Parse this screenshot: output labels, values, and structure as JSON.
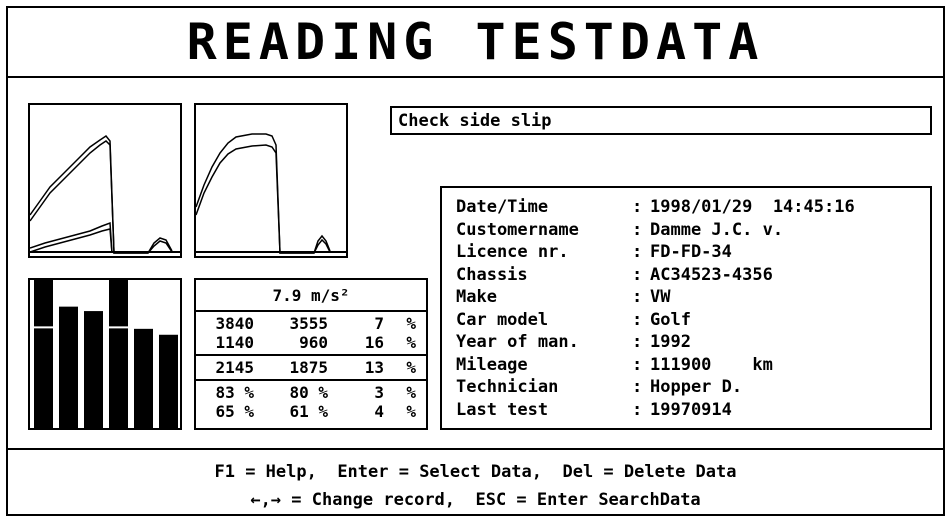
{
  "title": "READING TESTDATA",
  "message": "Check side slip",
  "numbers": {
    "header": "7.9 m/s²",
    "block1": [
      [
        "3840",
        "3555",
        "7",
        "%"
      ],
      [
        "1140",
        "960",
        "16",
        "%"
      ]
    ],
    "block2": [
      [
        "2145",
        "1875",
        "13",
        "%"
      ]
    ],
    "block3": [
      [
        "83 %",
        "80 %",
        "3",
        "%"
      ],
      [
        "65 %",
        "61 %",
        "4",
        "%"
      ]
    ]
  },
  "bars": {
    "values": [
      100,
      82,
      79,
      100,
      67,
      63
    ],
    "ticks": [
      68
    ]
  },
  "info": [
    {
      "label": "Date/Time",
      "value": "1998/01/29  14:45:16"
    },
    {
      "label": "Customername",
      "value": "Damme J.C. v."
    },
    {
      "label": "Licence nr.",
      "value": "FD-FD-34"
    },
    {
      "label": "Chassis",
      "value": "AC34523-4356"
    },
    {
      "label": "Make",
      "value": "VW"
    },
    {
      "label": "Car model",
      "value": "Golf"
    },
    {
      "label": "Year of man.",
      "value": "1992"
    },
    {
      "label": "Mileage",
      "value": "111900    km"
    },
    {
      "label": "Technician",
      "value": "Hopper D."
    },
    {
      "label": "Last test",
      "value": "19970914"
    }
  ],
  "footer": {
    "line1": "F1 = Help,  Enter = Select Data,  Del = Delete Data",
    "line2": "←,→ = Change record,  ESC = Enter SearchData"
  }
}
